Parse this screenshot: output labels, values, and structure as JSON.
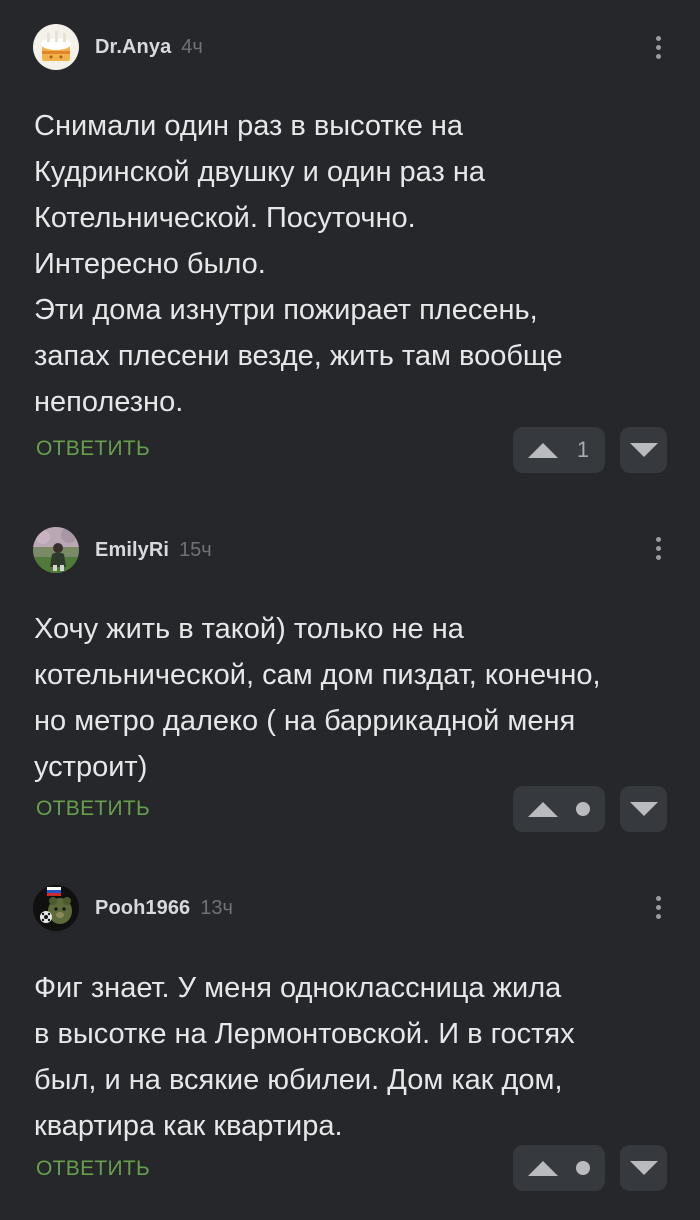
{
  "comments": [
    {
      "author": "Dr.Anya",
      "time": "4ч",
      "avatar_icon": "cake-icon",
      "lines": [
        "Снимали один раз в высотке на",
        "Кудринской двушку и один раз на",
        "Котельнической. Посуточно.",
        "Интересно было.",
        "Эти дома изнутри пожирает плесень,",
        "запах плесени везде, жить там вообще",
        "неполезно."
      ],
      "reply_label": "ОТВЕТИТЬ",
      "score": "1"
    },
    {
      "author": "EmilyRi",
      "time": "15ч",
      "avatar_icon": "user-photo-avatar",
      "lines": [
        "Хочу жить в такой) только не на",
        "котельнической, сам дом пиздат, конечно,",
        "но метро далеко ( на баррикадной меня",
        "устроит)"
      ],
      "reply_label": "ОТВЕТИТЬ",
      "score": ""
    },
    {
      "author": "Pooh1966",
      "time": "13ч",
      "avatar_icon": "bear-avatar",
      "lines": [
        "Фиг знает. У меня одноклассница жила",
        "в высотке на Лермонтовской. И в гостях",
        "был, и на всякие юбилеи. Дом как дом,",
        "квартира как квартира."
      ],
      "reply_label": "ОТВЕТИТЬ",
      "score": ""
    }
  ],
  "colors": {
    "background": "#25272b",
    "reply_green": "#66a04a",
    "vote_bg": "#36393e"
  }
}
